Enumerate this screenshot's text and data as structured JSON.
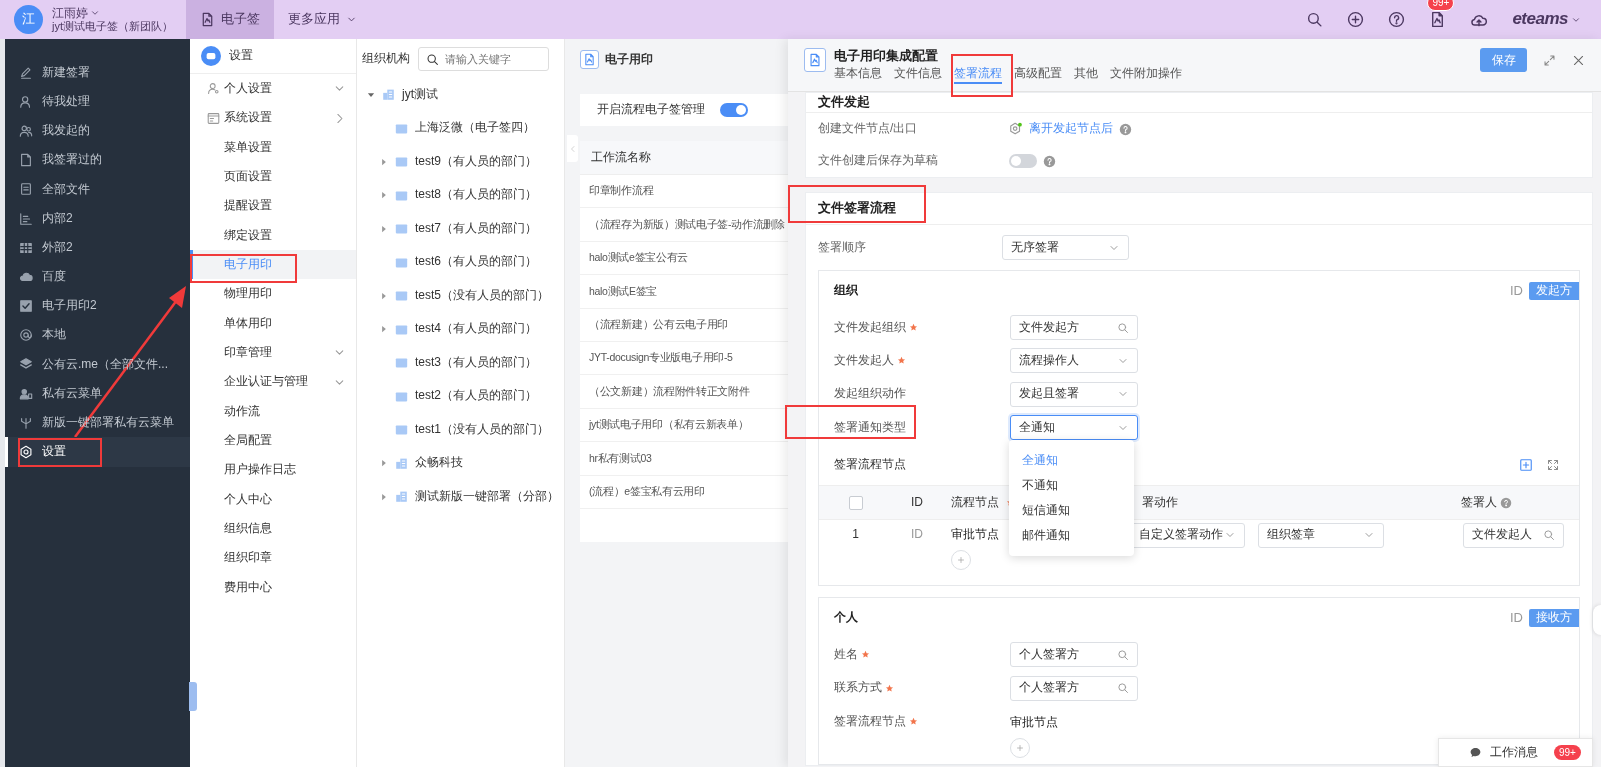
{
  "top_bar": {
    "avatar": "江",
    "user_name": "江雨婷",
    "team": "jyt测试电子签（新团队）",
    "apps": [
      {
        "label": "电子签",
        "selected": true
      },
      {
        "label": "更多应用",
        "selected": false
      }
    ],
    "notification_badge": "99+",
    "logo": "eteams"
  },
  "sidebar": {
    "items": [
      {
        "label": "新建签署",
        "selected": false
      },
      {
        "label": "待我处理",
        "selected": false
      },
      {
        "label": "我发起的",
        "selected": false
      },
      {
        "label": "我签署过的",
        "selected": false
      },
      {
        "label": "全部文件",
        "selected": false
      },
      {
        "label": "内部2",
        "selected": false
      },
      {
        "label": "外部2",
        "selected": false
      },
      {
        "label": "百度",
        "selected": false
      },
      {
        "label": "电子用印2",
        "selected": false
      },
      {
        "label": "本地",
        "selected": false
      },
      {
        "label": "公有云.me（全部文件...",
        "selected": false
      },
      {
        "label": "私有云菜单",
        "selected": false
      },
      {
        "label": "新版一键部署私有云菜单",
        "selected": false
      },
      {
        "label": "设置",
        "selected": true
      }
    ]
  },
  "settings_menu": {
    "title": "设置",
    "items": [
      {
        "label": "个人设置",
        "kind": "personal",
        "selected": false
      },
      {
        "label": "系统设置",
        "kind": "system",
        "selected": false
      },
      {
        "label": "菜单设置",
        "kind": "link",
        "selected": false
      },
      {
        "label": "页面设置",
        "kind": "link",
        "selected": false
      },
      {
        "label": "提醒设置",
        "kind": "link",
        "selected": false
      },
      {
        "label": "绑定设置",
        "kind": "link",
        "selected": false
      },
      {
        "label": "电子用印",
        "kind": "link",
        "selected": true
      },
      {
        "label": "物理用印",
        "kind": "link",
        "selected": false
      },
      {
        "label": "单体用印",
        "kind": "link",
        "selected": false
      },
      {
        "label": "印章管理",
        "kind": "group",
        "selected": false
      },
      {
        "label": "企业认证与管理",
        "kind": "group",
        "selected": false
      },
      {
        "label": "动作流",
        "kind": "link",
        "selected": false
      },
      {
        "label": "全局配置",
        "kind": "link",
        "selected": false
      },
      {
        "label": "用户操作日志",
        "kind": "link",
        "selected": false
      },
      {
        "label": "个人中心",
        "kind": "link",
        "selected": false
      },
      {
        "label": "组织信息",
        "kind": "link",
        "selected": false
      },
      {
        "label": "组织印章",
        "kind": "link",
        "selected": false
      },
      {
        "label": "费用中心",
        "kind": "link",
        "selected": false
      }
    ]
  },
  "org_tree": {
    "title": "组织机构",
    "search_placeholder": "请输入关键字",
    "nodes": [
      {
        "label": "jyt测试",
        "kind": "company",
        "expanded": true,
        "children": [
          {
            "label": "上海泛微（电子签四）",
            "kind": "department"
          },
          {
            "label": "test9（有人员的部门）",
            "kind": "department",
            "expanded": false
          },
          {
            "label": "test8（有人员的部门）",
            "kind": "department",
            "expanded": false
          },
          {
            "label": "test7（有人员的部门）",
            "kind": "department",
            "expanded": false
          },
          {
            "label": "test6（有人员的部门）",
            "kind": "department"
          },
          {
            "label": "test5（没有人员的部门）",
            "kind": "department",
            "expanded": false
          },
          {
            "label": "test4（有人员的部门）",
            "kind": "department",
            "expanded": false
          },
          {
            "label": "test3（有人员的部门）",
            "kind": "department"
          },
          {
            "label": "test2（有人员的部门）",
            "kind": "department"
          },
          {
            "label": "test1（没有人员的部门）",
            "kind": "department"
          },
          {
            "label": "众畅科技",
            "kind": "company",
            "expanded": false
          },
          {
            "label": "测试新版一键部署（分部）",
            "kind": "company",
            "expanded": false
          }
        ]
      }
    ]
  },
  "workflow_panel": {
    "title": "电子用印",
    "switch": {
      "label": "开启流程电子签管理",
      "on": true
    },
    "table": {
      "columns": [
        "工作流名称"
      ],
      "rows": [
        "印章制作流程",
        "（流程存为新版）测试电子签-动作流删除",
        "halo测试e签宝公有云",
        "halo测试E签宝",
        "（流程新建）公有云电子用印",
        "JYT-docusign专业版电子用印-5",
        "（公文新建）流程附件转正文附件",
        "jyt测试电子用印（私有云新表单）",
        "hr私有测试03",
        "(流程）e签宝私有云用印"
      ]
    }
  },
  "drawer": {
    "title": "电子用印集成配置",
    "tabs": [
      {
        "label": "基本信息",
        "selected": false
      },
      {
        "label": "文件信息",
        "selected": false
      },
      {
        "label": "签署流程",
        "selected": true
      },
      {
        "label": "高级配置",
        "selected": false
      },
      {
        "label": "其他",
        "selected": false
      },
      {
        "label": "文件附加操作",
        "selected": false
      }
    ],
    "save_button": "保存",
    "file_initiation": {
      "title": "文件发起",
      "rows": [
        {
          "kind": "link",
          "label": "创建文件节点/出口",
          "value": "离开发起节点后",
          "help": true
        },
        {
          "kind": "switch",
          "label": "文件创建后保存为草稿",
          "on": false,
          "help": true
        }
      ]
    },
    "signing_flow": {
      "title": "文件签署流程",
      "order": {
        "label": "签署顺序",
        "value": "无序签署"
      },
      "organization": {
        "title": "组织",
        "id_label": "ID",
        "tag": "发起方",
        "fields": [
          {
            "label": "文件发起组织",
            "required": true,
            "kind": "search",
            "value": "文件发起方",
            "focused": false
          },
          {
            "label": "文件发起人",
            "required": true,
            "kind": "select",
            "value": "流程操作人",
            "focused": false
          },
          {
            "label": "发起组织动作",
            "required": false,
            "kind": "select",
            "value": "发起且签署",
            "focused": false
          },
          {
            "label": "签署通知类型",
            "required": false,
            "kind": "select",
            "value": "全通知",
            "focused": true
          }
        ],
        "nodes": {
          "title": "签署流程节点",
          "header_checked": false,
          "columns": [
            {
              "label": "ID",
              "required": false,
              "help": false
            },
            {
              "label": "流程节点",
              "required": true,
              "help": false
            },
            {
              "label": "署动作",
              "required": false,
              "help": false
            },
            {
              "label": "签署人",
              "required": false,
              "help": true
            }
          ],
          "rows": [
            {
              "index": "1",
              "id": "ID",
              "node": "审批节点",
              "action": "自定义签署动作",
              "seal": "组织签章",
              "signer": "文件发起人"
            }
          ]
        }
      },
      "notice_dropdown": {
        "options": [
          {
            "label": "全通知",
            "selected": true
          },
          {
            "label": "不通知",
            "selected": false
          },
          {
            "label": "短信通知",
            "selected": false
          },
          {
            "label": "邮件通知",
            "selected": false
          }
        ]
      },
      "person": {
        "title": "个人",
        "id_label": "ID",
        "tag": "接收方",
        "fields": [
          {
            "label": "姓名",
            "required": true,
            "kind": "search",
            "value": "个人签署方",
            "focused": false
          },
          {
            "label": "联系方式",
            "required": true,
            "kind": "search",
            "value": "个人签署方",
            "focused": false
          },
          {
            "label": "签署流程节点",
            "required": true,
            "kind": "node",
            "value": "审批节点"
          }
        ]
      }
    }
  },
  "work_messages": {
    "label": "工作消息",
    "badge": "99+"
  }
}
